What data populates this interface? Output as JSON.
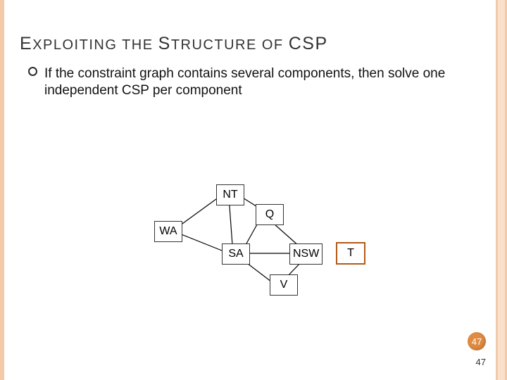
{
  "title_parts": {
    "e": "E",
    "xploiting_the": "XPLOITING THE ",
    "s": "S",
    "tructure_of": "TRUCTURE OF ",
    "csp": "CSP"
  },
  "body": "If the constraint graph contains several components, then solve one independent CSP per component",
  "nodes": {
    "NT": {
      "label": "NT"
    },
    "Q": {
      "label": "Q"
    },
    "WA": {
      "label": "WA"
    },
    "SA": {
      "label": "SA"
    },
    "NSW": {
      "label": "NSW"
    },
    "V": {
      "label": "V"
    },
    "T": {
      "label": "T"
    }
  },
  "edges": [
    [
      "WA",
      "NT"
    ],
    [
      "WA",
      "SA"
    ],
    [
      "NT",
      "SA"
    ],
    [
      "NT",
      "Q"
    ],
    [
      "SA",
      "Q"
    ],
    [
      "SA",
      "NSW"
    ],
    [
      "SA",
      "V"
    ],
    [
      "Q",
      "NSW"
    ],
    [
      "NSW",
      "V"
    ]
  ],
  "page": {
    "badge": "47",
    "num": "47"
  }
}
